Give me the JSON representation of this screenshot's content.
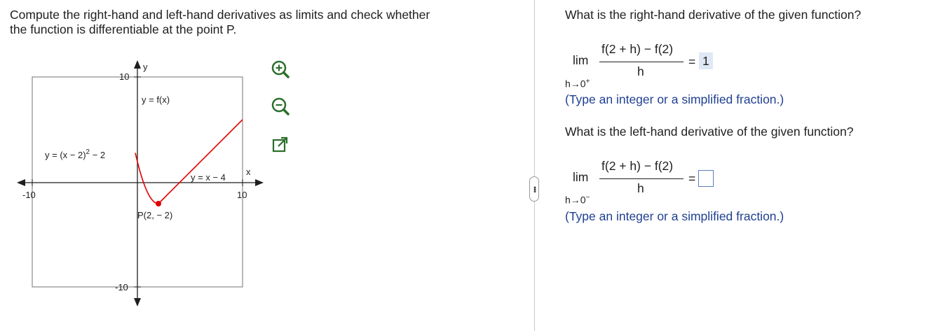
{
  "prompt": {
    "line1": "Compute the right-hand and left-hand derivatives as limits and check whether",
    "line2": "the function is differentiable at the point P."
  },
  "graph": {
    "y_axis_label": "y",
    "x_axis_label": "x",
    "tick_x_min": "-10",
    "tick_x_max": "10",
    "tick_y_max": "10",
    "tick_y_min": "-10",
    "curve_label": "y = f(x)",
    "parabola_label_base": "y = (x − 2)",
    "parabola_label_exp": "2",
    "parabola_label_tail": " − 2",
    "line_label": "y = x − 4",
    "point_label": "P(2, − 2)",
    "curve_color": "#e00000"
  },
  "tools": {
    "zoom_in": "zoom-in-icon",
    "zoom_out": "zoom-out-icon",
    "popout": "external-link-icon"
  },
  "q1": {
    "question": "What is the right-hand derivative of the given function?",
    "lim": "lim",
    "numerator": "f(2 + h) − f(2)",
    "denominator": "h",
    "equals": "=",
    "sub_base": "h→0",
    "sub_sign": "+",
    "answer": "1",
    "hint": "(Type an integer or a simplified fraction.)"
  },
  "q2": {
    "question": "What is the left-hand derivative of the given function?",
    "lim": "lim",
    "numerator": "f(2 + h) − f(2)",
    "denominator": "h",
    "equals": "=",
    "sub_base": "h→0",
    "sub_sign": "−",
    "answer": "",
    "hint": "(Type an integer or a simplified fraction.)"
  },
  "divider": {
    "handle_glyph": "•••"
  }
}
